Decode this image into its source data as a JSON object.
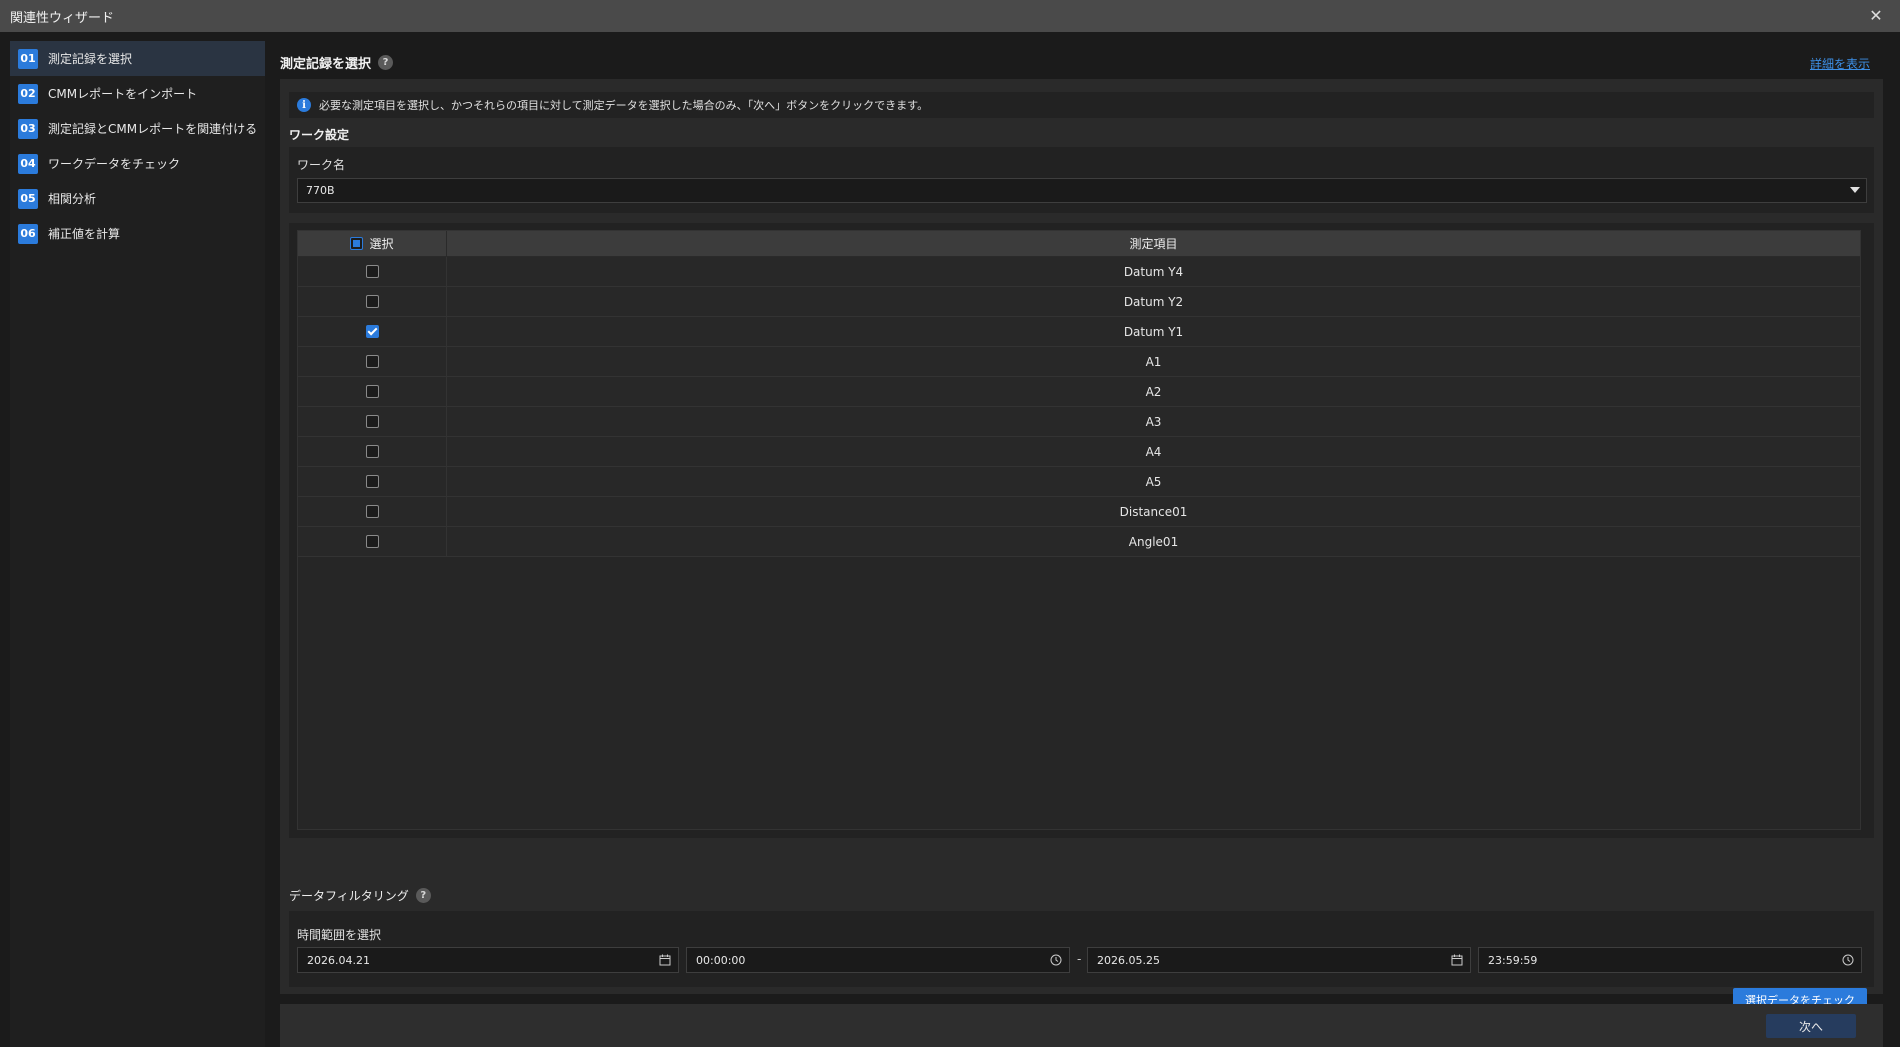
{
  "window": {
    "title": "関連性ウィザード",
    "close": "✕"
  },
  "steps": [
    {
      "num": "01",
      "label": "測定記録を選択"
    },
    {
      "num": "02",
      "label": "CMMレポートをインポート"
    },
    {
      "num": "03",
      "label": "測定記録とCMMレポートを関連付ける"
    },
    {
      "num": "04",
      "label": "ワークデータをチェック"
    },
    {
      "num": "05",
      "label": "相関分析"
    },
    {
      "num": "06",
      "label": "補正値を計算"
    }
  ],
  "main": {
    "title": "測定記録を選択",
    "help": "?",
    "details_link": "詳細を表示",
    "info_icon": "i",
    "info": "必要な測定項目を選択し、かつそれらの項目に対して測定データを選択した場合のみ、「次へ」ボタンをクリックできます。",
    "work_section": "ワーク設定",
    "work_name_label": "ワーク名",
    "work_name_value": "770B"
  },
  "table": {
    "col_select": "選択",
    "col_item": "測定項目",
    "rows": [
      {
        "item": "Datum Y4",
        "checked": false
      },
      {
        "item": "Datum Y2",
        "checked": false
      },
      {
        "item": "Datum Y1",
        "checked": true
      },
      {
        "item": "A1",
        "checked": false
      },
      {
        "item": "A2",
        "checked": false
      },
      {
        "item": "A3",
        "checked": false
      },
      {
        "item": "A4",
        "checked": false
      },
      {
        "item": "A5",
        "checked": false
      },
      {
        "item": "Distance01",
        "checked": false
      },
      {
        "item": "Angle01",
        "checked": false
      }
    ]
  },
  "filter": {
    "section": "データフィルタリング",
    "help": "?",
    "range_label": "時間範囲を選択",
    "start_date": "2026.04.21",
    "start_time": "00:00:00",
    "separator": "-",
    "end_date": "2026.05.25",
    "end_time": "23:59:59",
    "check_button": "選択データをチェック"
  },
  "footer": {
    "next_button": "次へ"
  },
  "colors": {
    "accent": "#2b7bdc",
    "link": "#3d8fe6",
    "next_bg": "#263c5e"
  }
}
